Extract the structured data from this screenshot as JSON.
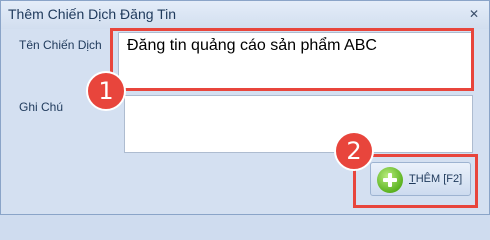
{
  "window": {
    "title": "Thêm Chiến Dịch Đăng Tin",
    "close_icon": "close-icon"
  },
  "form": {
    "campaign_name_label": "Tên Chiến Dịch",
    "campaign_name_value": "Đăng tin quảng cáo sản phẩm ABC",
    "note_label": "Ghi Chú",
    "note_value": ""
  },
  "add_button": {
    "label_underlined": "T",
    "label_rest": "HÊM [F2]",
    "icon": "plus-circle-icon"
  },
  "annotations": {
    "step1": "1",
    "step2": "2",
    "color": "#e8453c"
  }
}
